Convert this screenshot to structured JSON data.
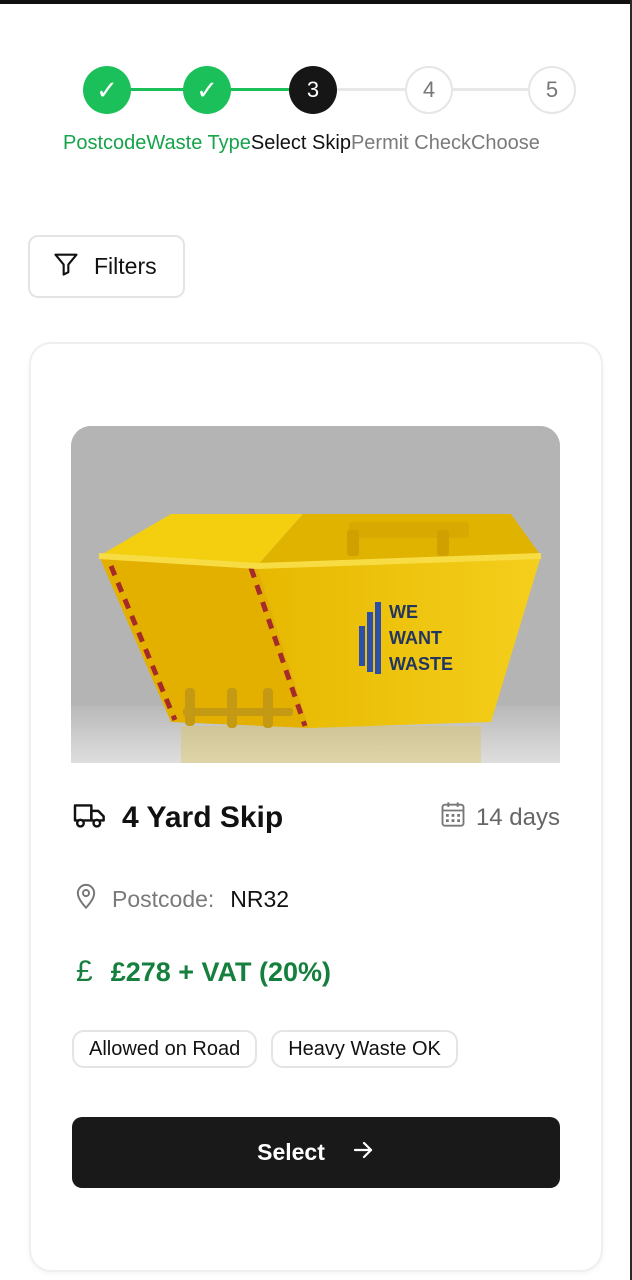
{
  "stepper": {
    "steps": [
      {
        "label": "Postcode",
        "state": "done",
        "marker": "✓"
      },
      {
        "label": "Waste Type",
        "state": "done",
        "marker": "✓"
      },
      {
        "label": "Select Skip",
        "state": "current",
        "marker": "3"
      },
      {
        "label": "Permit Check",
        "state": "todo",
        "marker": "4"
      },
      {
        "label": "Choose",
        "state": "todo",
        "marker": "5"
      }
    ]
  },
  "filters": {
    "label": "Filters",
    "icon": "filter-icon"
  },
  "skip": {
    "title": "4 Yard Skip",
    "hire_period": "14 days",
    "postcode_label": "Postcode:",
    "postcode_value": "NR32",
    "currency_symbol": "£",
    "price": "£278 + VAT (20%)",
    "tags": [
      "Allowed on Road",
      "Heavy Waste OK"
    ],
    "image_logo_lines": [
      "WE",
      "WANT",
      "WASTE"
    ],
    "select_label": "Select"
  },
  "colors": {
    "accent_green": "#1cc05a",
    "price_green": "#15803d",
    "dark": "#191919",
    "skip_yellow": "#f2c200"
  }
}
